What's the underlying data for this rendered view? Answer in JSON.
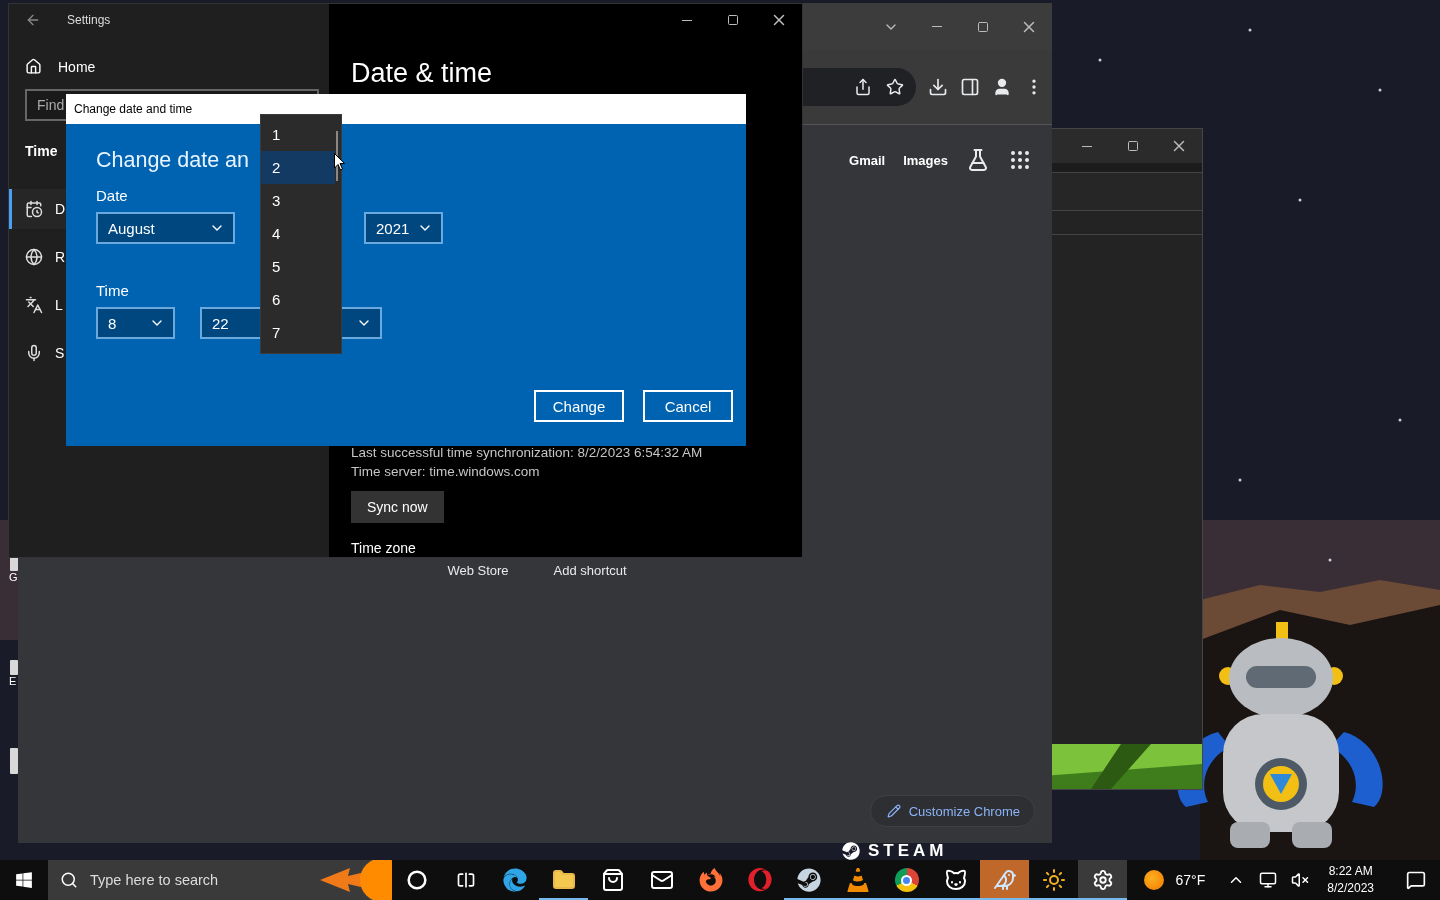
{
  "settings": {
    "title": "Settings",
    "home": "Home",
    "search_placeholder": "Find",
    "section": "Time",
    "nav": [
      {
        "label": "D",
        "kind": "calendar",
        "selected": true
      },
      {
        "label": "R",
        "kind": "globe",
        "selected": false
      },
      {
        "label": "L",
        "kind": "language",
        "selected": false
      },
      {
        "label": "S",
        "kind": "mic",
        "selected": false
      }
    ],
    "heading": "Date & time",
    "sync_lines": [
      "Last successful time synchronization: 8/2/2023 6:54:32 AM",
      "Time server: time.windows.com"
    ],
    "sync_button": "Sync now",
    "time_zone": "Time zone"
  },
  "dialog": {
    "window_title": "Change date and time",
    "heading": "Change date an",
    "date_label": "Date",
    "month": "August",
    "year": "2021",
    "time_label": "Time",
    "hour": "8",
    "minute": "22",
    "buttons": [
      "Change",
      "Cancel"
    ]
  },
  "day_dropdown": {
    "items": [
      {
        "label": "1",
        "selected": false
      },
      {
        "label": "2",
        "selected": true
      },
      {
        "label": "3",
        "selected": false
      },
      {
        "label": "4",
        "selected": false
      },
      {
        "label": "5",
        "selected": false
      },
      {
        "label": "6",
        "selected": false
      },
      {
        "label": "7",
        "selected": false
      }
    ]
  },
  "chrome": {
    "header_links": [
      "Gmail",
      "Images"
    ],
    "shortcuts": [
      "Web Store",
      "Add shortcut"
    ],
    "customize_button": "Customize Chrome"
  },
  "steam_banner": "STEAM",
  "desktop_icons": [
    {
      "label": "G"
    },
    {
      "label": "E"
    }
  ],
  "taskbar": {
    "search_placeholder": "Type here to search",
    "apps": [
      {
        "kind": "cortana",
        "running": false,
        "flashing": false,
        "selected": false
      },
      {
        "kind": "taskview",
        "running": false,
        "flashing": false,
        "selected": false
      },
      {
        "kind": "edge",
        "running": false,
        "flashing": false,
        "selected": false
      },
      {
        "kind": "explorer",
        "running": true,
        "flashing": false,
        "selected": false
      },
      {
        "kind": "store",
        "running": false,
        "flashing": false,
        "selected": false
      },
      {
        "kind": "mail",
        "running": false,
        "flashing": false,
        "selected": false
      },
      {
        "kind": "firefox",
        "running": false,
        "flashing": false,
        "selected": false
      },
      {
        "kind": "opera",
        "running": false,
        "flashing": false,
        "selected": false
      },
      {
        "kind": "steam",
        "running": true,
        "flashing": false,
        "selected": false
      },
      {
        "kind": "vlc",
        "running": true,
        "flashing": false,
        "selected": false
      },
      {
        "kind": "chrome",
        "running": true,
        "flashing": false,
        "selected": false
      },
      {
        "kind": "mask",
        "running": true,
        "flashing": false,
        "selected": false
      },
      {
        "kind": "bird",
        "running": true,
        "flashing": true,
        "selected": false
      },
      {
        "kind": "sun",
        "running": true,
        "flashing": false,
        "selected": false
      },
      {
        "kind": "settings",
        "running": true,
        "flashing": false,
        "selected": true
      }
    ],
    "weather": "67°F",
    "time": "8:22 AM",
    "date": "8/2/2023"
  }
}
